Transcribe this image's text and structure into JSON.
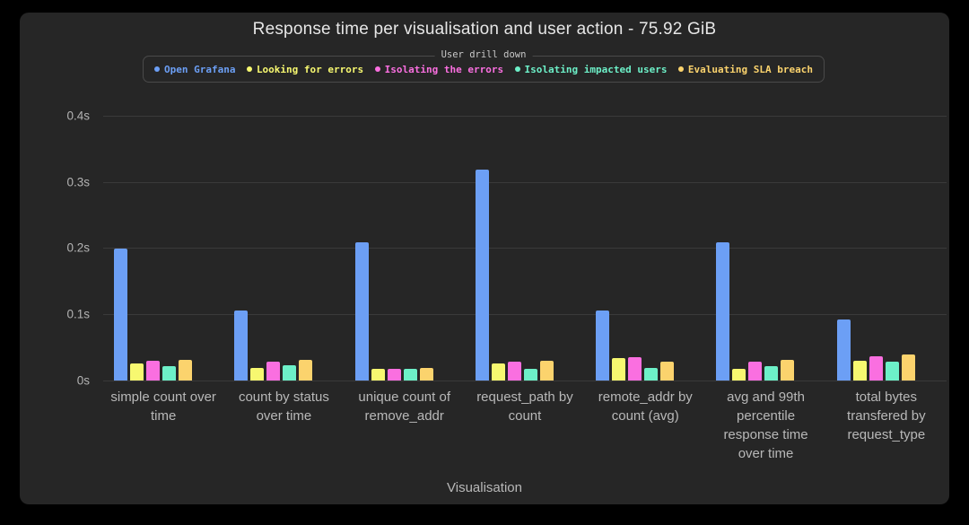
{
  "panel": {
    "title": "Response time per visualisation and user action - 75.92 GiB",
    "background": "#262626",
    "outer_background": "#000000"
  },
  "legend": {
    "title": "User drill down",
    "position": "top-center",
    "items": [
      {
        "label": "Open Grafana",
        "color": "#6c9ff5",
        "icon": "legend-dot-icon"
      },
      {
        "label": "Looking for errors",
        "color": "#f7f870",
        "icon": "legend-dot-icon"
      },
      {
        "label": "Isolating the errors",
        "color": "#fa6fe0",
        "icon": "legend-dot-icon"
      },
      {
        "label": "Isolating impacted users",
        "color": "#6df0c8",
        "icon": "legend-dot-icon"
      },
      {
        "label": "Evaluating SLA breach",
        "color": "#fbd36d",
        "icon": "legend-dot-icon"
      }
    ]
  },
  "axes": {
    "y_ticks": [
      "0.4s",
      "0.3s",
      "0.2s",
      "0.1s",
      "0s"
    ],
    "y_tick_values": [
      0.4,
      0.3,
      0.2,
      0.1,
      0
    ],
    "x_title": "Visualisation",
    "y_title": "",
    "grid": true
  },
  "chart_data": {
    "type": "bar",
    "title": "Response time per visualisation and user action - 75.92 GiB",
    "xlabel": "Visualisation",
    "ylabel": "",
    "ylim": [
      0,
      0.42
    ],
    "grid": true,
    "legend_position": "top-center",
    "legend_title": "User drill down",
    "unit": "s",
    "categories": [
      "simple count over time",
      "count by status over time",
      "unique count of remove_addr",
      "request_path by count",
      "remote_addr by count (avg)",
      "avg and 99th percentile response time over time",
      "total bytes transfered by request_type"
    ],
    "series": [
      {
        "name": "Open Grafana",
        "color": "#6c9ff5",
        "values": [
          0.199,
          0.106,
          0.208,
          0.318,
          0.106,
          0.208,
          0.092
        ]
      },
      {
        "name": "Looking for errors",
        "color": "#f7f870",
        "values": [
          0.026,
          0.019,
          0.018,
          0.026,
          0.034,
          0.018,
          0.03
        ]
      },
      {
        "name": "Isolating the errors",
        "color": "#fa6fe0",
        "values": [
          0.03,
          0.029,
          0.018,
          0.028,
          0.035,
          0.029,
          0.036
        ]
      },
      {
        "name": "Isolating impacted users",
        "color": "#6df0c8",
        "values": [
          0.022,
          0.023,
          0.018,
          0.018,
          0.019,
          0.022,
          0.028
        ]
      },
      {
        "name": "Evaluating SLA breach",
        "color": "#fbd36d",
        "values": [
          0.031,
          0.031,
          0.019,
          0.03,
          0.029,
          0.031,
          0.039
        ]
      }
    ]
  }
}
